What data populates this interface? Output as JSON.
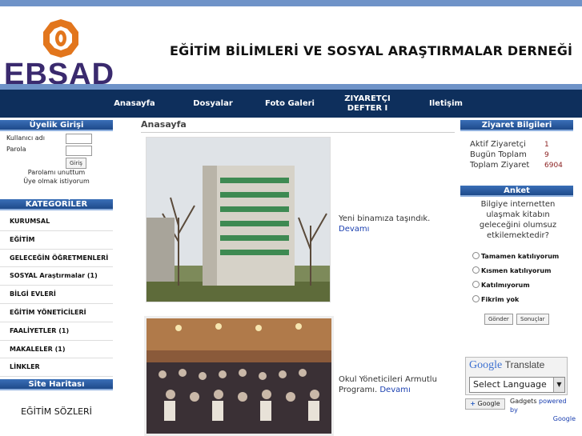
{
  "header": {
    "logo_text": "EBSAD",
    "site_title": "EĞİTİM BİLİMLERİ VE SOSYAL ARAŞTIRMALAR DERNEĞİ"
  },
  "nav": {
    "items": [
      "Anasayfa",
      "Dosyalar",
      "Foto Galeri",
      "ZIYARETÇI DEFTER I",
      "Iletişim"
    ]
  },
  "login": {
    "title": "Üyelik Girişi",
    "username_label": "Kullanıcı adı",
    "password_label": "Parola",
    "submit": "Giriş",
    "forgot": "Parolamı unuttum",
    "register": "Üye olmak istiyorum"
  },
  "categories": {
    "title": "KATEGORİLER",
    "items": [
      "KURUMSAL",
      "EĞİTİM",
      "GELECEĞİN ÖĞRETMENLERİ",
      "SOSYAL Araştırmalar (1)",
      "BİLGİ EVLERİ",
      "EĞİTİM YÖNETİCİLERİ",
      "FAALİYETLER (1)",
      "MAKALELER (1)",
      "LİNKLER"
    ]
  },
  "sitemap": {
    "title": "Site Haritası",
    "item": "EĞİTİM SÖZLERİ"
  },
  "main": {
    "title": "Anasayfa",
    "posts": [
      {
        "text": "Yeni binamıza taşındık.",
        "more": "Devamı"
      },
      {
        "text": "Okul Yöneticileri Armutlu Programı.",
        "more": "Devamı"
      }
    ]
  },
  "visitors": {
    "title": "Ziyaret Bilgileri",
    "rows": [
      {
        "label": "Aktif Ziyaretçi",
        "value": "1"
      },
      {
        "label": "Bugün Toplam",
        "value": "9"
      },
      {
        "label": "Toplam Ziyaret",
        "value": "6904"
      }
    ]
  },
  "poll": {
    "title": "Anket",
    "question": "Bilgiye internetten ulaşmak kitabın geleceğini olumsuz etkilemektedir?",
    "options": [
      "Tamamen katılıyorum",
      "Kısmen katılıyorum",
      "Katılmıyorum",
      "Fikrim yok"
    ],
    "vote": "Gönder",
    "results": "Sonuçlar"
  },
  "translate": {
    "brand": "Google",
    "word": "Translate",
    "select": "Select Language",
    "gadgets": "Gadgets",
    "powered": "powered by",
    "google": "Google",
    "badge": "Google"
  },
  "colors": {
    "nav_bg": "#0e2f5c",
    "accent": "#6f93c8",
    "link": "#1a3fb0"
  }
}
